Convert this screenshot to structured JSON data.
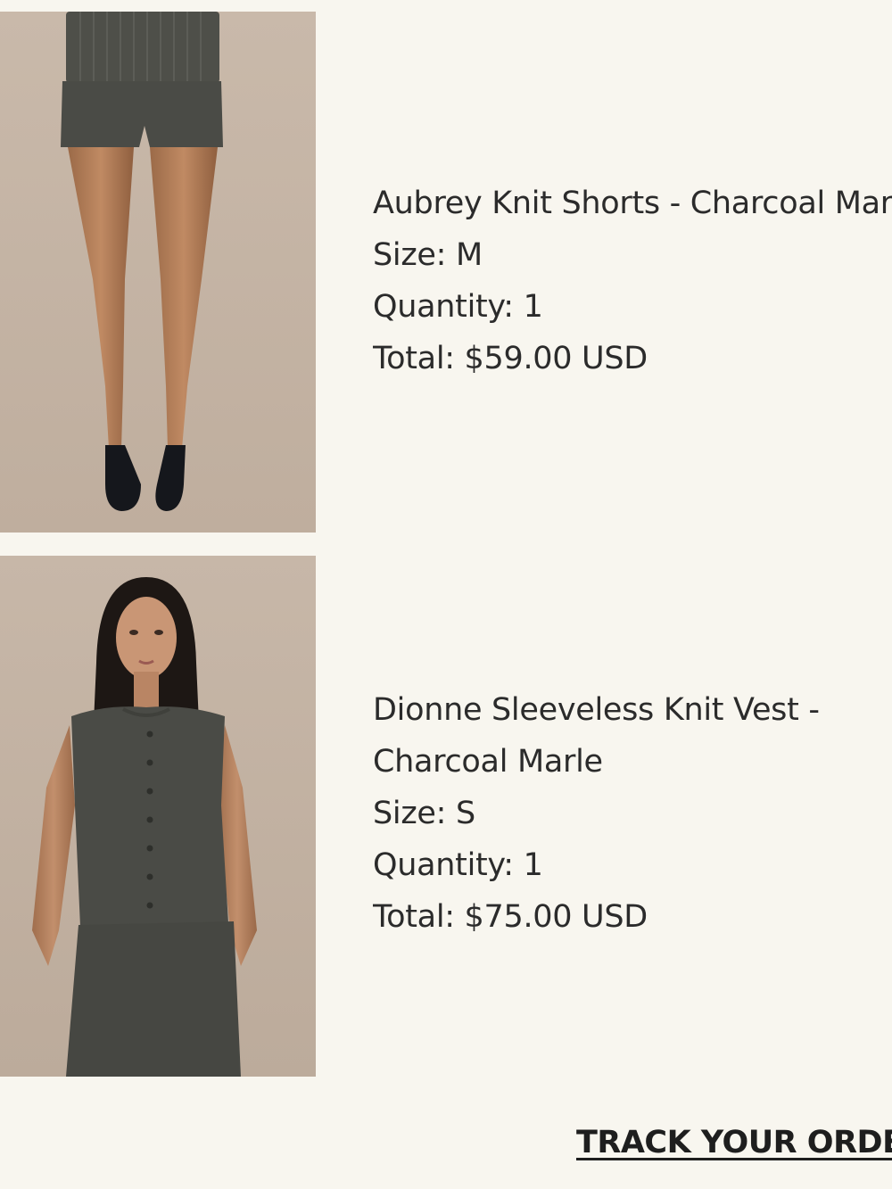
{
  "order_items": [
    {
      "name": "Aubrey Knit Shorts - Charcoal Marle",
      "size": "Size: M",
      "quantity": "Quantity: 1",
      "total": "Total: $59.00 USD"
    },
    {
      "name_line1": "Dionne Sleeveless Knit Vest -",
      "name_line2": "Charcoal Marle",
      "size": "Size: S",
      "quantity": "Quantity: 1",
      "total": "Total: $75.00 USD"
    }
  ],
  "actions": {
    "track_order_label": "TRACK YOUR ORDER"
  },
  "colors": {
    "background": "#f8f6ef",
    "text": "#2b2b2b",
    "photo_backdrop": "#c5b6a7",
    "garment": "#4a4b46"
  }
}
